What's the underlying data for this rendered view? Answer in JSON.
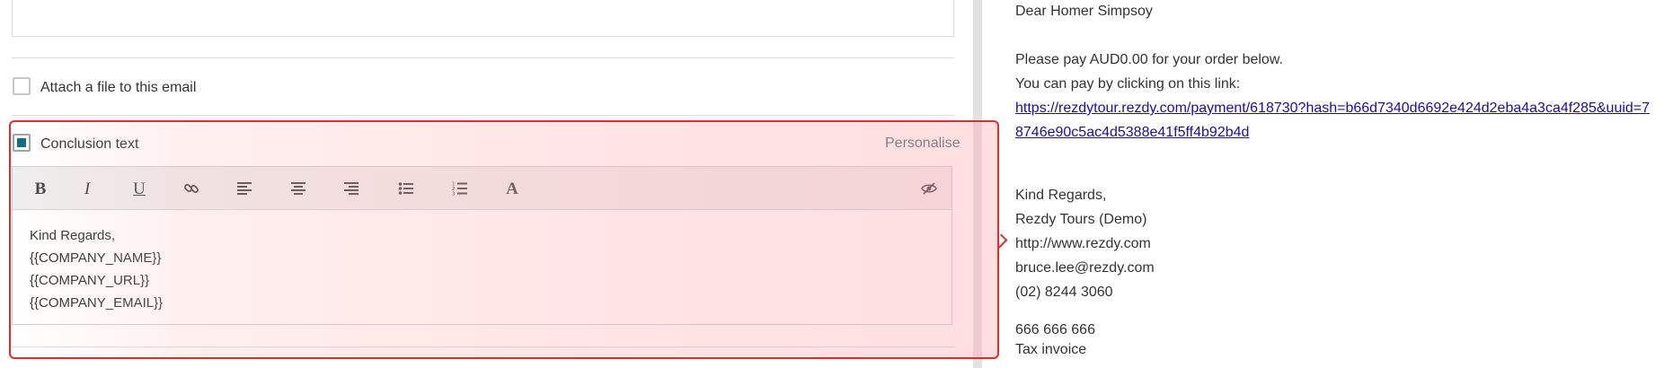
{
  "attach": {
    "label": "Attach a file to this email",
    "checked": false
  },
  "conclusion": {
    "label": "Conclusion text",
    "checked": true,
    "personalise_label": "Personalise",
    "toolbar": {
      "bold": "B",
      "italic": "I",
      "underline": "U",
      "link_icon": "link-icon",
      "align_left_icon": "align-left-icon",
      "align_center_icon": "align-center-icon",
      "align_right_icon": "align-right-icon",
      "bullet_list_icon": "bullet-list-icon",
      "numbered_list_icon": "numbered-list-icon",
      "font_color": "A",
      "toggle_source_icon": "eye-slash-icon"
    },
    "lines": [
      "Kind Regards,",
      "{{COMPANY_NAME}}",
      "{{COMPANY_URL}}",
      "{{COMPANY_EMAIL}}"
    ]
  },
  "preview": {
    "greeting": "Dear Homer Simpsoy",
    "pay_line": "Please pay AUD0.00 for your order below.",
    "link_intro": "You can pay by clicking on this link:",
    "payment_link": {
      "line1": "https://rezdytour.rezdy.com/payment/618730?hash=b66d7340d6692e424d2eba4a3ca4f285&uuid=7",
      "line2": "8746e90c5ac4d5388e41f5ff4b92b4d"
    },
    "signoff": "Kind Regards,",
    "company_name": "Rezdy Tours (Demo)",
    "company_url": "http://www.rezdy.com",
    "company_email": "bruce.lee@rezdy.com",
    "company_phone": "(02) 8244 3060",
    "extra_number": "666 666 666",
    "tax_invoice": "Tax invoice"
  },
  "colors": {
    "highlight_border": "#e32b2b",
    "checkbox_fill": "#0f6f86",
    "link": "#1a0dab",
    "personalise": "#4e6d78"
  }
}
